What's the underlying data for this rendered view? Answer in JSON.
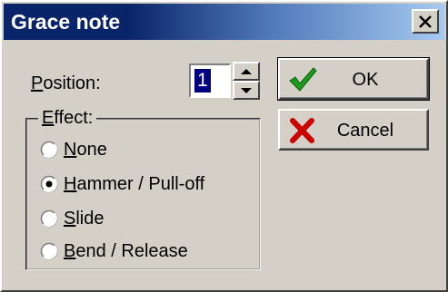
{
  "window": {
    "title": "Grace note",
    "close_icon": "close-icon"
  },
  "position": {
    "label_prefix": "",
    "label_accel": "P",
    "label_rest": "osition:",
    "value": "1",
    "spin_up_icon": "spin-up-icon",
    "spin_down_icon": "spin-down-icon"
  },
  "effect": {
    "legend_accel": "E",
    "legend_rest": "ffect:",
    "options": [
      {
        "accel": "N",
        "rest": "one",
        "selected": false
      },
      {
        "accel": "H",
        "rest": "ammer / Pull-off",
        "selected": true
      },
      {
        "accel": "S",
        "rest": "lide",
        "selected": false
      },
      {
        "accel": "B",
        "rest": "end / Release",
        "selected": false
      }
    ]
  },
  "buttons": {
    "ok_label": "OK",
    "ok_icon": "checkmark-icon",
    "cancel_label": "Cancel",
    "cancel_icon": "cross-icon"
  },
  "colors": {
    "titlebar_start": "#0a246a",
    "titlebar_end": "#a6caf0",
    "face": "#d4d0c8",
    "selection": "#000080",
    "ok_green": "#1a9c1a",
    "cancel_red": "#cc0000"
  }
}
